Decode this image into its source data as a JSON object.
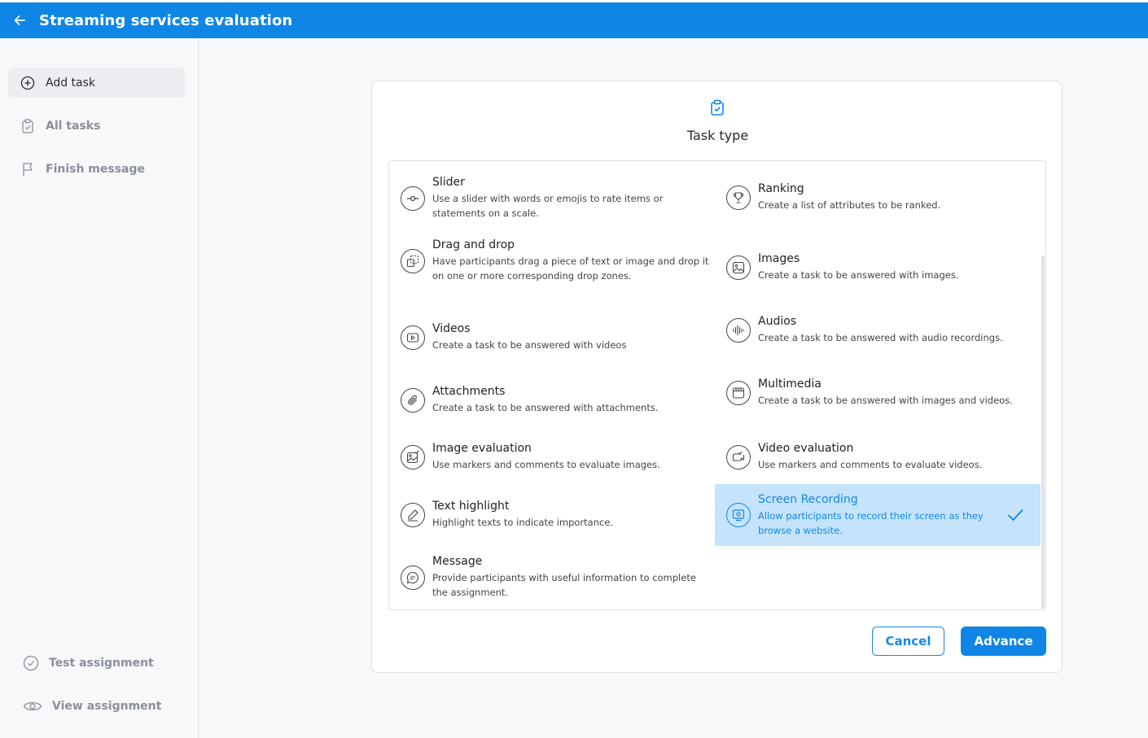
{
  "header": {
    "title": "Streaming services evaluation"
  },
  "sidebar": {
    "items": [
      {
        "label": "Add task",
        "icon": "plus-circle-icon"
      },
      {
        "label": "All tasks",
        "icon": "clipboard-check-icon"
      },
      {
        "label": "Finish message",
        "icon": "flag-icon"
      }
    ],
    "bottom": [
      {
        "label": "Test assignment",
        "icon": "check-circle-icon"
      },
      {
        "label": "View assignment",
        "icon": "eye-icon"
      }
    ]
  },
  "modal": {
    "title": "Task type",
    "cancel": "Cancel",
    "advance": "Advance",
    "options": [
      {
        "name": "Slider",
        "desc": "Use a slider with words or emojis to rate items or statements on a scale.",
        "icon": "slider-icon"
      },
      {
        "name": "Ranking",
        "desc": "Create a list of attributes to be ranked.",
        "icon": "trophy-icon"
      },
      {
        "name": "Drag and drop",
        "desc": "Have participants drag a piece of text or image and drop it on one or more corresponding drop zones.",
        "icon": "drag-drop-icon"
      },
      {
        "name": "Images",
        "desc": "Create a task to be answered with images.",
        "icon": "image-icon"
      },
      {
        "name": "Videos",
        "desc": "Create a task to be answered with videos",
        "icon": "video-icon"
      },
      {
        "name": "Audios",
        "desc": "Create a task to be answered with audio recordings.",
        "icon": "audio-icon"
      },
      {
        "name": "Attachments",
        "desc": "Create a task to be answered with attachments.",
        "icon": "paperclip-icon"
      },
      {
        "name": "Multimedia",
        "desc": "Create a task to be answered with images and videos.",
        "icon": "multimedia-icon"
      },
      {
        "name": "Image evaluation",
        "desc": "Use markers and comments to evaluate images.",
        "icon": "image-evaluation-icon"
      },
      {
        "name": "Video evaluation",
        "desc": "Use markers and comments to evaluate videos.",
        "icon": "video-evaluation-icon"
      },
      {
        "name": "Text highlight",
        "desc": "Highlight texts to indicate importance.",
        "icon": "pen-icon"
      },
      {
        "name": "Screen Recording",
        "desc": "Allow participants to record their screen as they browse a website.",
        "icon": "screen-recording-icon",
        "selected": true
      },
      {
        "name": "Message",
        "desc": "Provide participants with useful information to complete the assignment.",
        "icon": "message-icon"
      }
    ]
  },
  "colors": {
    "accent": "#0f86e6",
    "selected_bg": "#c5e3fb"
  }
}
